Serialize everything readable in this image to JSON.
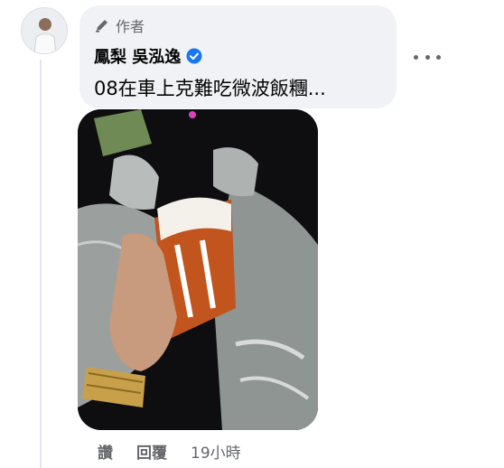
{
  "comment": {
    "author_badge": "作者",
    "author_name": "鳳梨 吳泓逸",
    "text": "08在車上克難吃微波飯糰..."
  },
  "actions": {
    "like": "讚",
    "reply": "回覆",
    "timestamp": "19小時"
  },
  "icons": {
    "badge": "pen-icon",
    "verified": "verified-badge-icon",
    "more": "more-options-icon"
  },
  "colors": {
    "bubble": "#f0f2f5",
    "verified": "#1877f2",
    "muted_text": "#65676b"
  }
}
